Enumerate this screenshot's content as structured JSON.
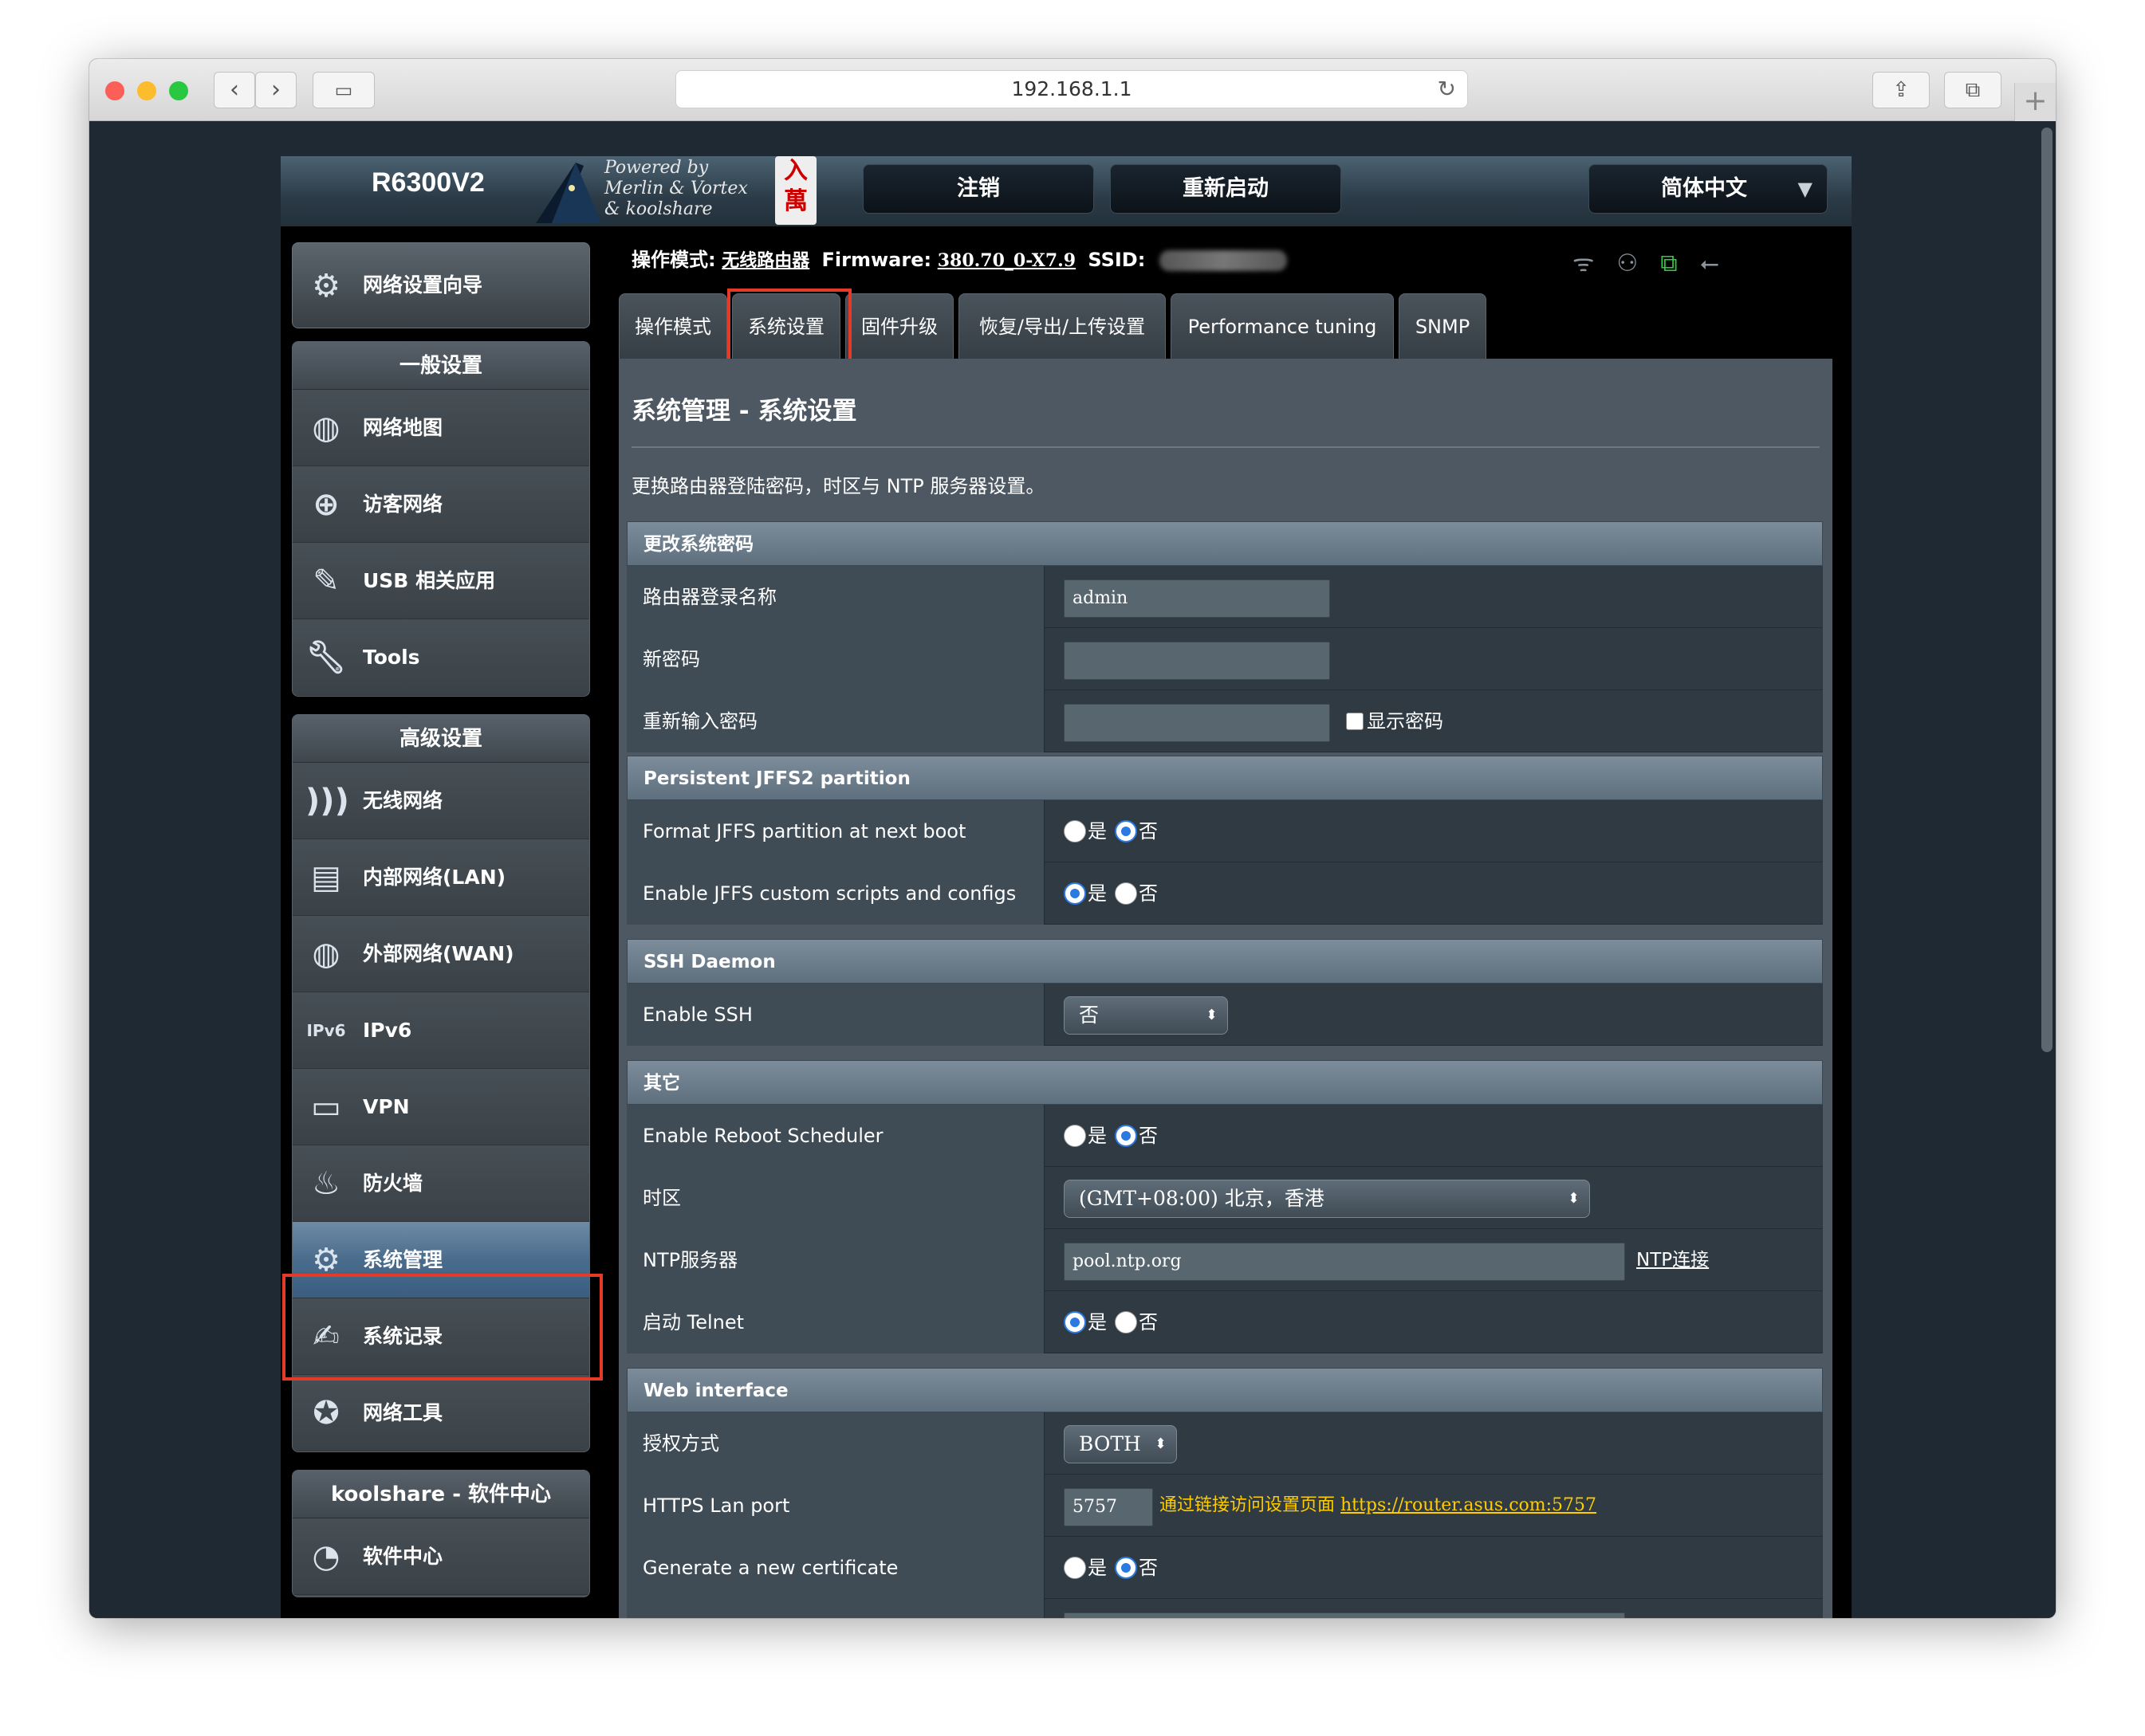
{
  "browser": {
    "url": "192.168.1.1",
    "traffic_lights": {
      "close": "#fc5f57",
      "minimize": "#fdbc2e",
      "zoom": "#28c840"
    },
    "icons": [
      "back-icon",
      "forward-icon",
      "sidebar-icon",
      "reload-icon",
      "share-icon",
      "tabs-icon",
      "new-tab-icon"
    ]
  },
  "header": {
    "model": "R6300V2",
    "powered_by": "Powered by\nMerlin & Vortex\n& koolshare",
    "logout": "注销",
    "reboot": "重新启动",
    "language": "简体中文"
  },
  "status": {
    "mode_label": "操作模式:",
    "mode_value": "无线路由器",
    "firmware_label": "Firmware:",
    "firmware_value": "380.70_0-X7.9",
    "ssid_label": "SSID:"
  },
  "sidebar": {
    "wizard": "网络设置向导",
    "general_title": "一般设置",
    "general": [
      {
        "label": "网络地图",
        "icon": "globe-icon"
      },
      {
        "label": "访客网络",
        "icon": "guest-network-icon"
      },
      {
        "label": "USB 相关应用",
        "icon": "usb-icon"
      },
      {
        "label": "Tools",
        "icon": "wrench-icon"
      }
    ],
    "advanced_title": "高级设置",
    "advanced": [
      {
        "label": "无线网络",
        "icon": "wireless-icon"
      },
      {
        "label": "内部网络(LAN)",
        "icon": "lan-icon"
      },
      {
        "label": "外部网络(WAN)",
        "icon": "wan-globe-icon"
      },
      {
        "label": "IPv6",
        "icon": "ipv6-icon"
      },
      {
        "label": "VPN",
        "icon": "vpn-icon"
      },
      {
        "label": "防火墙",
        "icon": "firewall-icon"
      },
      {
        "label": "系统管理",
        "icon": "admin-icon",
        "active": true
      },
      {
        "label": "系统记录",
        "icon": "log-icon"
      },
      {
        "label": "网络工具",
        "icon": "network-tools-icon"
      }
    ],
    "koolshare_title": "koolshare - 软件中心",
    "koolshare": [
      {
        "label": "软件中心",
        "icon": "software-center-icon"
      }
    ]
  },
  "tabs": [
    "操作模式",
    "系统设置",
    "固件升级",
    "恢复/导出/上传设置",
    "Performance tuning",
    "SNMP"
  ],
  "active_tab": "系统设置",
  "panel": {
    "title": "系统管理 - 系统设置",
    "description": "更换路由器登陆密码，时区与 NTP 服务器设置。",
    "sections": {
      "password": {
        "title": "更改系统密码",
        "login_name_label": "路由器登录名称",
        "login_name_value": "admin",
        "new_password_label": "新密码",
        "confirm_password_label": "重新输入密码",
        "show_password_label": "显示密码"
      },
      "jffs": {
        "title": "Persistent JFFS2 partition",
        "format_label": "Format JFFS partition at next boot",
        "format_value": "否",
        "scripts_label": "Enable JFFS custom scripts and configs",
        "scripts_value": "是"
      },
      "ssh": {
        "title": "SSH Daemon",
        "enable_label": "Enable SSH",
        "enable_value": "否"
      },
      "other": {
        "title": "其它",
        "reboot_sched_label": "Enable Reboot Scheduler",
        "reboot_sched_value": "否",
        "timezone_label": "时区",
        "timezone_value": "(GMT+08:00) 北京，香港",
        "ntp_label": "NTP服务器",
        "ntp_value": "pool.ntp.org",
        "ntp_link": "NTP连接",
        "telnet_label": "启动 Telnet",
        "telnet_value": "是"
      },
      "web": {
        "title": "Web interface",
        "auth_label": "授权方式",
        "auth_value": "BOTH",
        "https_port_label": "HTTPS Lan port",
        "https_port_value": "5757",
        "https_hint": "通过链接访问设置页面",
        "https_url": "https://router.asus.com:5757",
        "cert_label": "Generate a new certificate",
        "cert_value": "否"
      }
    },
    "yes": "是",
    "no": "否"
  },
  "colors": {
    "highlight": "#e53a2a",
    "radio_on": "#2a7ae2",
    "link_yellow": "#ffcc00"
  }
}
